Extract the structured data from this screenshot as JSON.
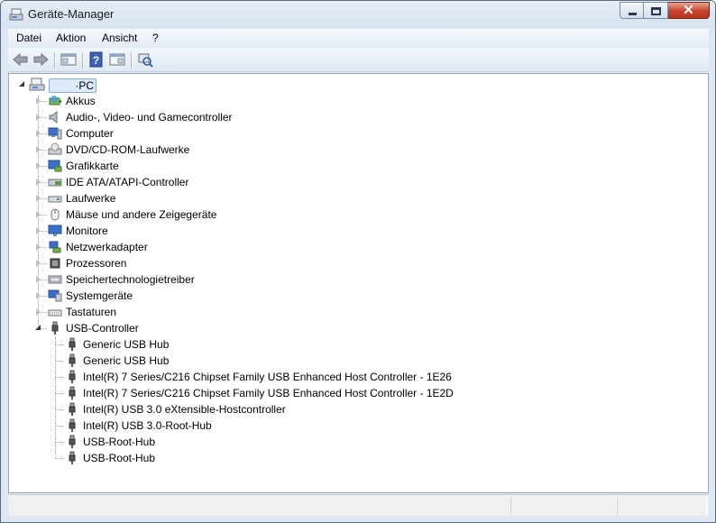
{
  "window": {
    "title": "Geräte-Manager"
  },
  "menu": [
    {
      "label": "Datei"
    },
    {
      "label": "Aktion"
    },
    {
      "label": "Ansicht"
    },
    {
      "label": "?"
    }
  ],
  "toolbar": {
    "buttons": [
      {
        "icon": "back-arrow-icon"
      },
      {
        "icon": "forward-arrow-icon"
      },
      {
        "icon": "properties-pane-icon"
      },
      {
        "icon": "help-icon"
      },
      {
        "icon": "console-tree-icon"
      },
      {
        "icon": "scan-hardware-icon"
      }
    ]
  },
  "tree": {
    "root": {
      "label": "·PC",
      "expanded": true
    },
    "categories": [
      {
        "label": "Akkus",
        "icon": "battery-icon"
      },
      {
        "label": "Audio-, Video- und Gamecontroller",
        "icon": "speaker-icon"
      },
      {
        "label": "Computer",
        "icon": "computer-icon"
      },
      {
        "label": "DVD/CD-ROM-Laufwerke",
        "icon": "dvd-drive-icon"
      },
      {
        "label": "Grafikkarte",
        "icon": "display-adapter-icon"
      },
      {
        "label": "IDE ATA/ATAPI-Controller",
        "icon": "ide-controller-icon"
      },
      {
        "label": "Laufwerke",
        "icon": "disk-drive-icon"
      },
      {
        "label": "Mäuse und andere Zeigegeräte",
        "icon": "mouse-icon"
      },
      {
        "label": "Monitore",
        "icon": "monitor-icon"
      },
      {
        "label": "Netzwerkadapter",
        "icon": "network-adapter-icon"
      },
      {
        "label": "Prozessoren",
        "icon": "processor-icon"
      },
      {
        "label": "Speichertechnologietreiber",
        "icon": "storage-driver-icon"
      },
      {
        "label": "Systemgeräte",
        "icon": "system-devices-icon"
      },
      {
        "label": "Tastaturen",
        "icon": "keyboard-icon"
      },
      {
        "label": "USB-Controller",
        "icon": "usb-plug-icon",
        "expanded": true
      }
    ],
    "usb_children": [
      {
        "label": "Generic USB Hub"
      },
      {
        "label": "Generic USB Hub"
      },
      {
        "label": "Intel(R) 7 Series/C216 Chipset Family USB Enhanced Host Controller - 1E26"
      },
      {
        "label": "Intel(R) 7 Series/C216 Chipset Family USB Enhanced Host Controller - 1E2D"
      },
      {
        "label": "Intel(R) USB 3.0 eXtensible-Hostcontroller"
      },
      {
        "label": "Intel(R) USB 3.0-Root-Hub"
      },
      {
        "label": "USB-Root-Hub"
      },
      {
        "label": "USB-Root-Hub"
      }
    ]
  },
  "colors": {
    "selection_fill": "#dceaf9",
    "selection_border": "#84acdd",
    "close_button": "#c7432a"
  }
}
